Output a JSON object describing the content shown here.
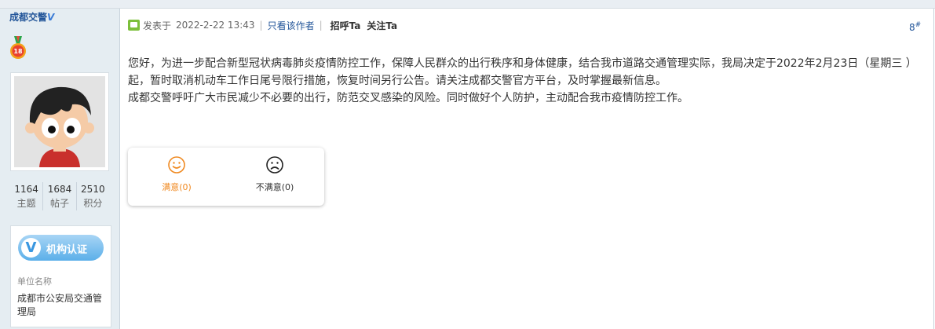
{
  "sidebar": {
    "author_name": "成都交警",
    "author_badge": "V",
    "medal_number": "18",
    "stats": [
      {
        "value": "1164",
        "label": "主题"
      },
      {
        "value": "1684",
        "label": "帖子"
      },
      {
        "value": "2510",
        "label": "积分"
      }
    ],
    "org": {
      "badge_letter": "V",
      "badge_text": "机构认证",
      "label": "单位名称",
      "name": "成都市公安局交通管理局"
    }
  },
  "post": {
    "posted_prefix": "发表于",
    "posted_time": "2022-2-22 13:43",
    "only_author": "只看该作者",
    "greet": "招呼Ta",
    "follow": "关注Ta",
    "floor_number": "8",
    "floor_suffix": "#",
    "content_lines": [
      "您好，为进一步配合新型冠状病毒肺炎疫情防控工作，保障人民群众的出行秩序和身体健康，结合我市道路交通管理实际，我局决定于2022年2月23日（星期三 ）起，暂时取消机动车工作日尾号限行措施，恢复时间另行公告。请关注成都交警官方平台，及时掌握最新信息。",
      "成都交警呼吁广大市民减少不必要的出行，防范交叉感染的风险。同时做好个人防护，主动配合我市疫情防控工作。"
    ]
  },
  "rating": {
    "satisfied_label": "满意(0)",
    "unsatisfied_label": "不满意(0)",
    "satisfied_color": "#f08a22",
    "unsatisfied_color": "#333333"
  }
}
